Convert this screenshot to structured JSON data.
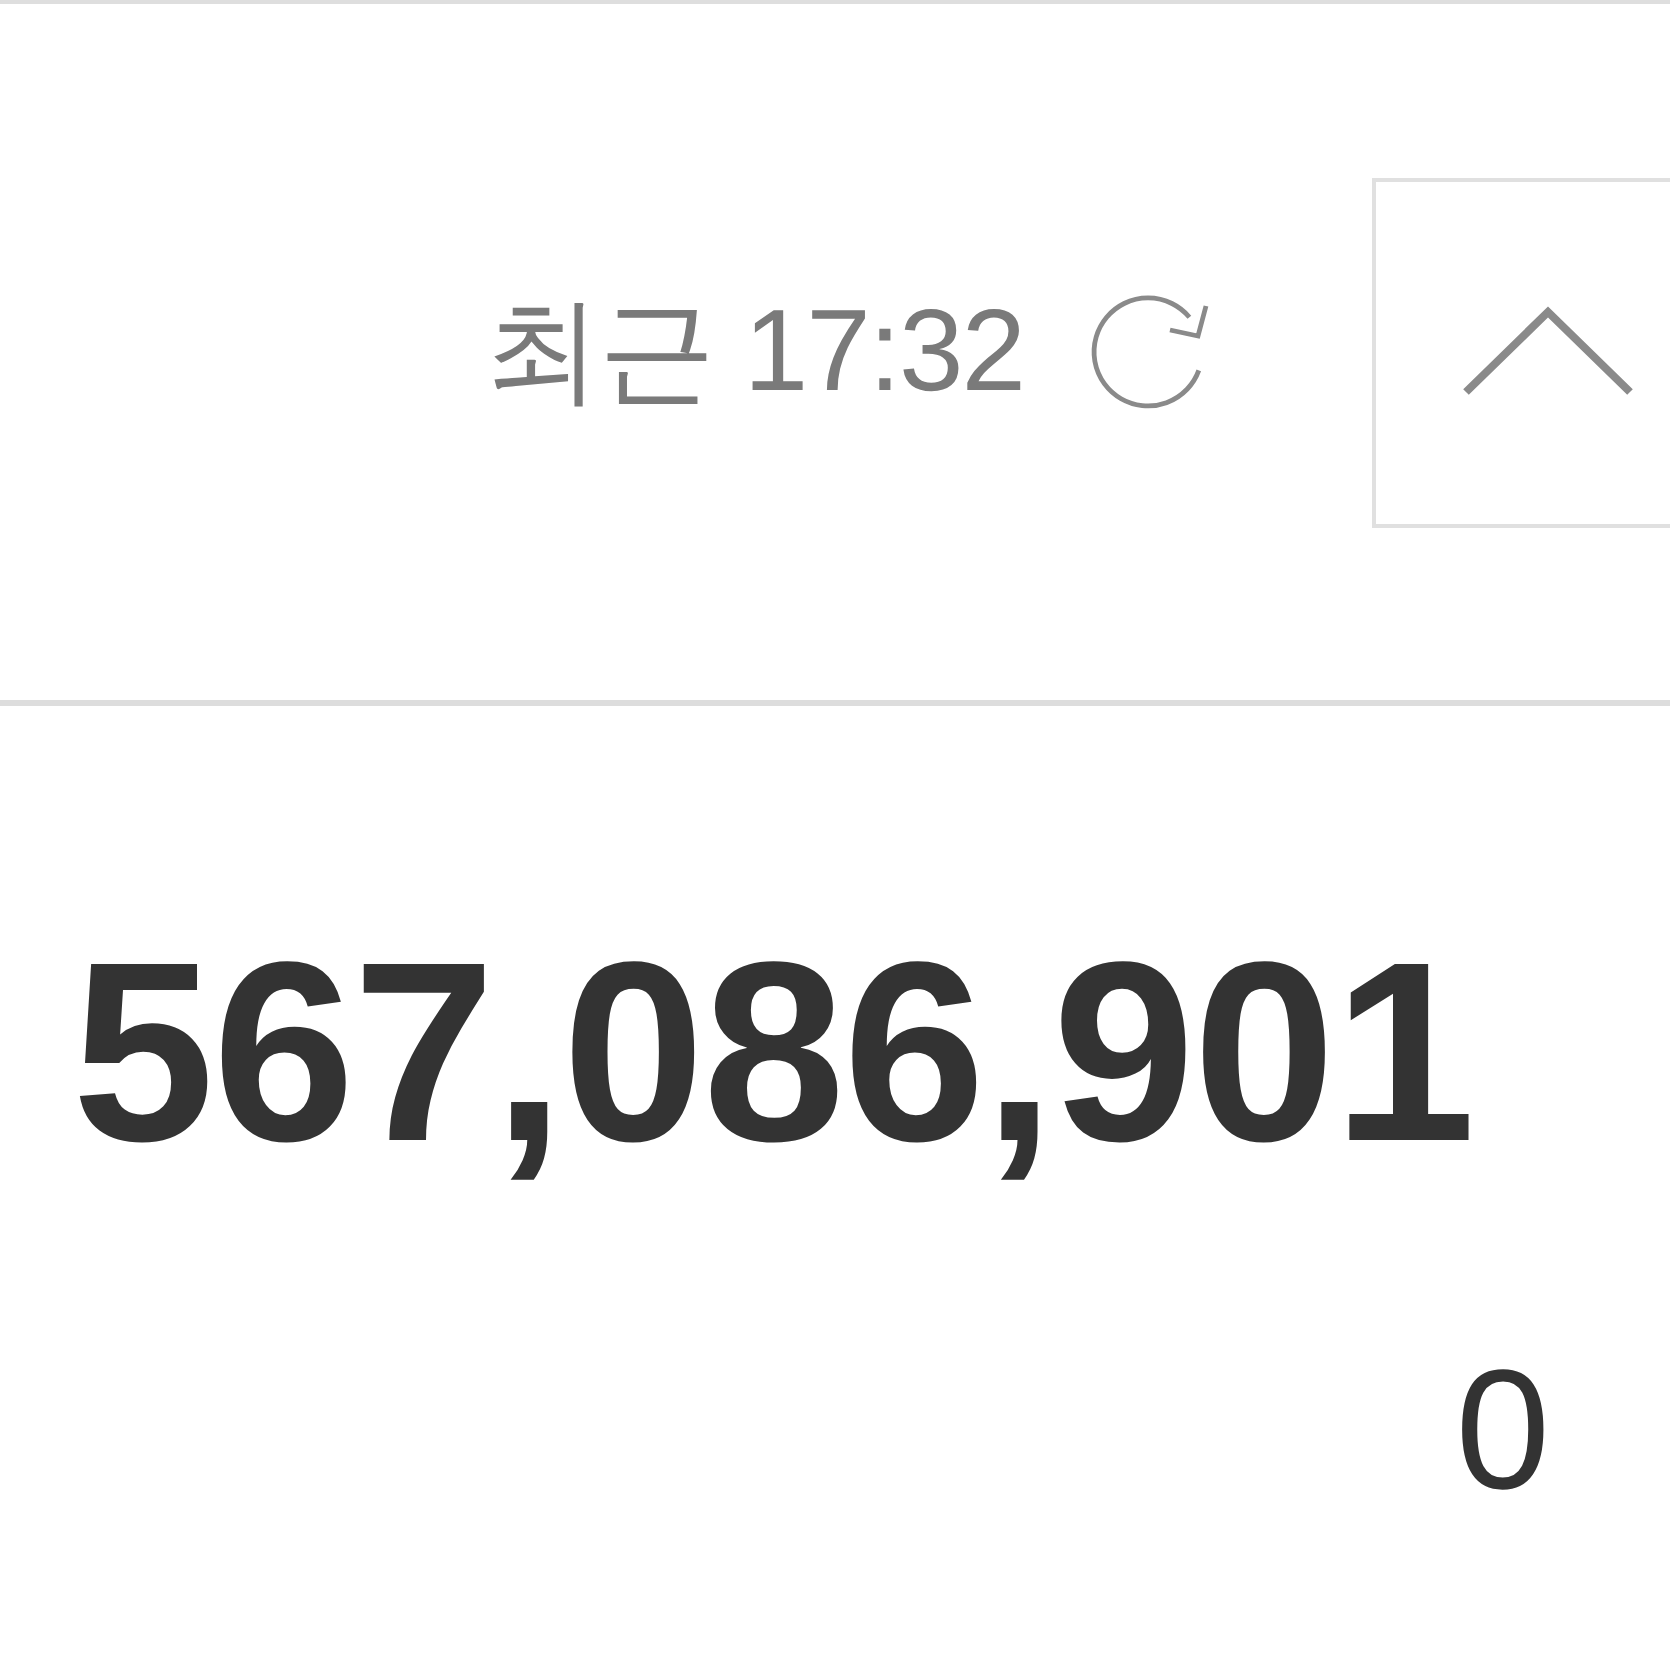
{
  "header": {
    "last_updated": "최근 17:32",
    "expanded": true
  },
  "balance": {
    "amount": "567,086,901",
    "secondary_amount": "0"
  }
}
